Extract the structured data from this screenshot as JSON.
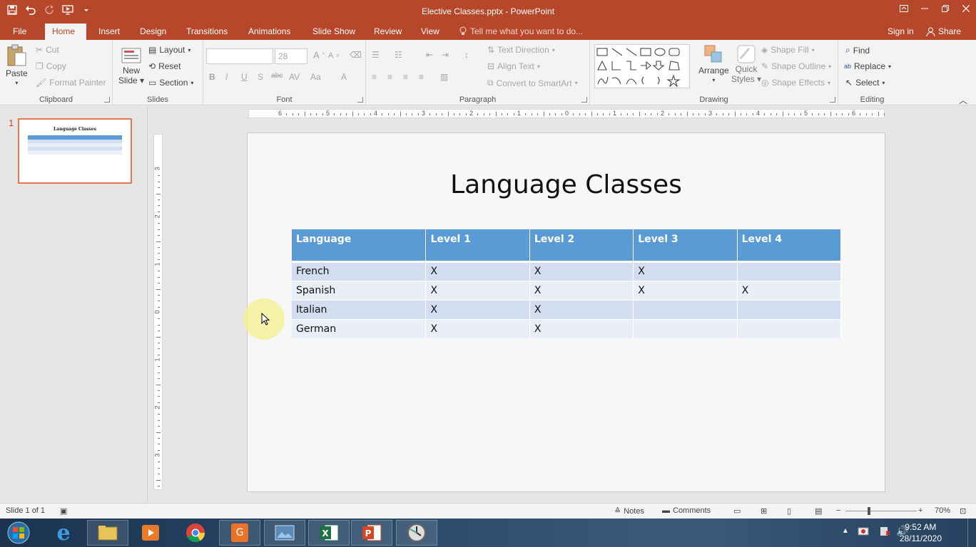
{
  "window": {
    "title": "Elective Classes.pptx - PowerPoint"
  },
  "tabs": [
    "File",
    "Home",
    "Insert",
    "Design",
    "Transitions",
    "Animations",
    "Slide Show",
    "Review",
    "View"
  ],
  "tell_me": "Tell me what you want to do...",
  "account": {
    "signin": "Sign in",
    "share": "Share"
  },
  "ribbon": {
    "clipboard": {
      "paste": "Paste",
      "cut": "Cut",
      "copy": "Copy",
      "format_painter": "Format Painter",
      "label": "Clipboard"
    },
    "slides": {
      "new_slide_1": "New",
      "new_slide_2": "Slide",
      "layout": "Layout",
      "reset": "Reset",
      "section": "Section",
      "label": "Slides"
    },
    "font": {
      "font_name": "",
      "font_size": "28",
      "label": "Font"
    },
    "paragraph": {
      "text_direction": "Text Direction",
      "align_text": "Align Text",
      "convert_smartart": "Convert to SmartArt",
      "label": "Paragraph"
    },
    "drawing": {
      "arrange": "Arrange",
      "quick_styles_1": "Quick",
      "quick_styles_2": "Styles",
      "shape_fill": "Shape Fill",
      "shape_outline": "Shape Outline",
      "shape_effects": "Shape Effects",
      "label": "Drawing"
    },
    "editing": {
      "find": "Find",
      "replace": "Replace",
      "select": "Select",
      "label": "Editing"
    }
  },
  "ruler": {
    "h_ticks": [
      "6",
      "5",
      "4",
      "3",
      "2",
      "1",
      "0",
      "1",
      "2",
      "3",
      "4",
      "5",
      "6"
    ],
    "v_ticks": [
      "3",
      "2",
      "1",
      "0",
      "1",
      "2",
      "3"
    ]
  },
  "thumbnails": [
    {
      "number": "1",
      "title": "Language Classes"
    }
  ],
  "slide": {
    "title": "Language Classes",
    "table": {
      "headers": [
        "Language",
        "Level 1",
        "Level 2",
        "Level 3",
        "Level 4"
      ],
      "rows": [
        [
          "French",
          "X",
          "X",
          "X",
          ""
        ],
        [
          "Spanish",
          "X",
          "X",
          "X",
          "X"
        ],
        [
          "Italian",
          "X",
          "X",
          "",
          ""
        ],
        [
          "German",
          "X",
          "X",
          "",
          ""
        ]
      ]
    }
  },
  "status": {
    "slide_of": "Slide 1 of 1",
    "notes": "Notes",
    "comments": "Comments",
    "zoom": "70%"
  },
  "taskbar": {
    "time": "9:52 AM",
    "date": "28/11/2020",
    "apps": [
      "start",
      "internet-explorer",
      "file-explorer",
      "media-player",
      "chrome",
      "pdf-app",
      "photo-viewer",
      "excel",
      "powerpoint",
      "clock-app"
    ]
  },
  "colors": {
    "accent": "#b7472a",
    "table_header": "#5b9bd5",
    "table_row_odd": "#d2deef",
    "table_row_even": "#e9eef7"
  }
}
